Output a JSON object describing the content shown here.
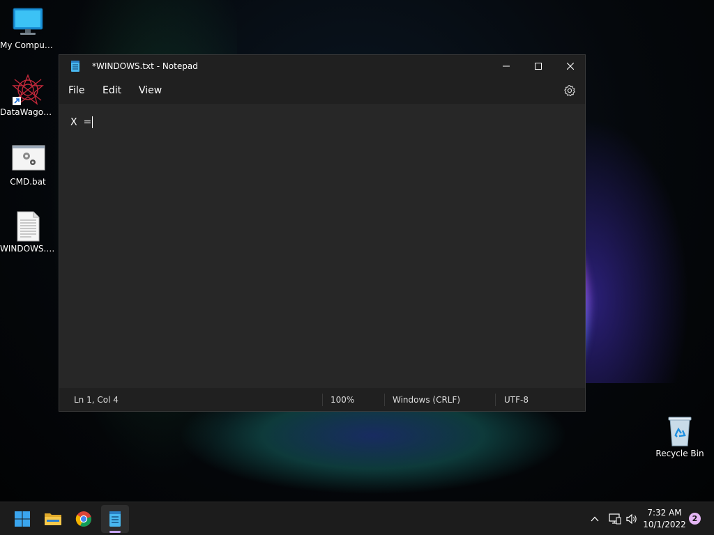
{
  "desktop": {
    "icons": [
      {
        "label": "My Computer"
      },
      {
        "label": "DataWagon..."
      },
      {
        "label": "CMD.bat"
      },
      {
        "label": "WINDOWS.txt"
      },
      {
        "label": "Recycle Bin"
      }
    ]
  },
  "notepad": {
    "title": "*WINDOWS.txt - Notepad",
    "menu": {
      "file": "File",
      "edit": "Edit",
      "view": "View"
    },
    "content": "X  =",
    "status": {
      "position": "Ln 1, Col 4",
      "zoom": "100%",
      "line_ending": "Windows (CRLF)",
      "encoding": "UTF-8"
    }
  },
  "taskbar": {
    "clock_time": "7:32 AM",
    "clock_date": "10/1/2022",
    "notification_count": "2"
  },
  "colors": {
    "window_bg": "#202020",
    "editor_bg": "#272727",
    "taskbar_bg": "#1c1c1c",
    "accent": "#c8a7f7"
  }
}
